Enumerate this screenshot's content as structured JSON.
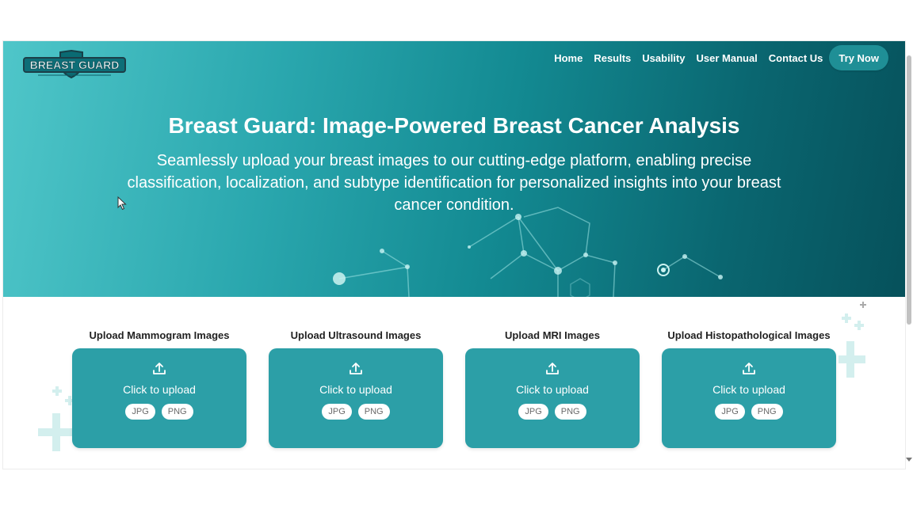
{
  "logo": {
    "text": "BREAST GUARD"
  },
  "nav": {
    "items": [
      {
        "label": "Home"
      },
      {
        "label": "Results"
      },
      {
        "label": "Usability"
      },
      {
        "label": "User Manual"
      },
      {
        "label": "Contact Us"
      }
    ],
    "cta_label": "Try Now"
  },
  "hero": {
    "title": "Breast Guard: Image-Powered Breast Cancer Analysis",
    "subtitle": "Seamlessly upload your breast images to our cutting-edge platform, enabling precise classification, localization, and subtype identification for personalized insights into your breast cancer condition."
  },
  "uploads": [
    {
      "title": "Upload Mammogram Images",
      "label": "Click to upload",
      "formats": [
        "JPG",
        "PNG"
      ]
    },
    {
      "title": "Upload Ultrasound Images",
      "label": "Click to upload",
      "formats": [
        "JPG",
        "PNG"
      ]
    },
    {
      "title": "Upload MRI Images",
      "label": "Click to upload",
      "formats": [
        "JPG",
        "PNG"
      ]
    },
    {
      "title": "Upload Histopathological Images",
      "label": "Click to upload",
      "formats": [
        "JPG",
        "PNG"
      ]
    }
  ],
  "colors": {
    "accent": "#2c9fa7",
    "hero_start": "#4fc6c9",
    "hero_end": "#06515b"
  },
  "icons": {
    "upload": "upload-icon",
    "cursor": "mouse-cursor-icon",
    "decor": "medical-cross-icon"
  }
}
